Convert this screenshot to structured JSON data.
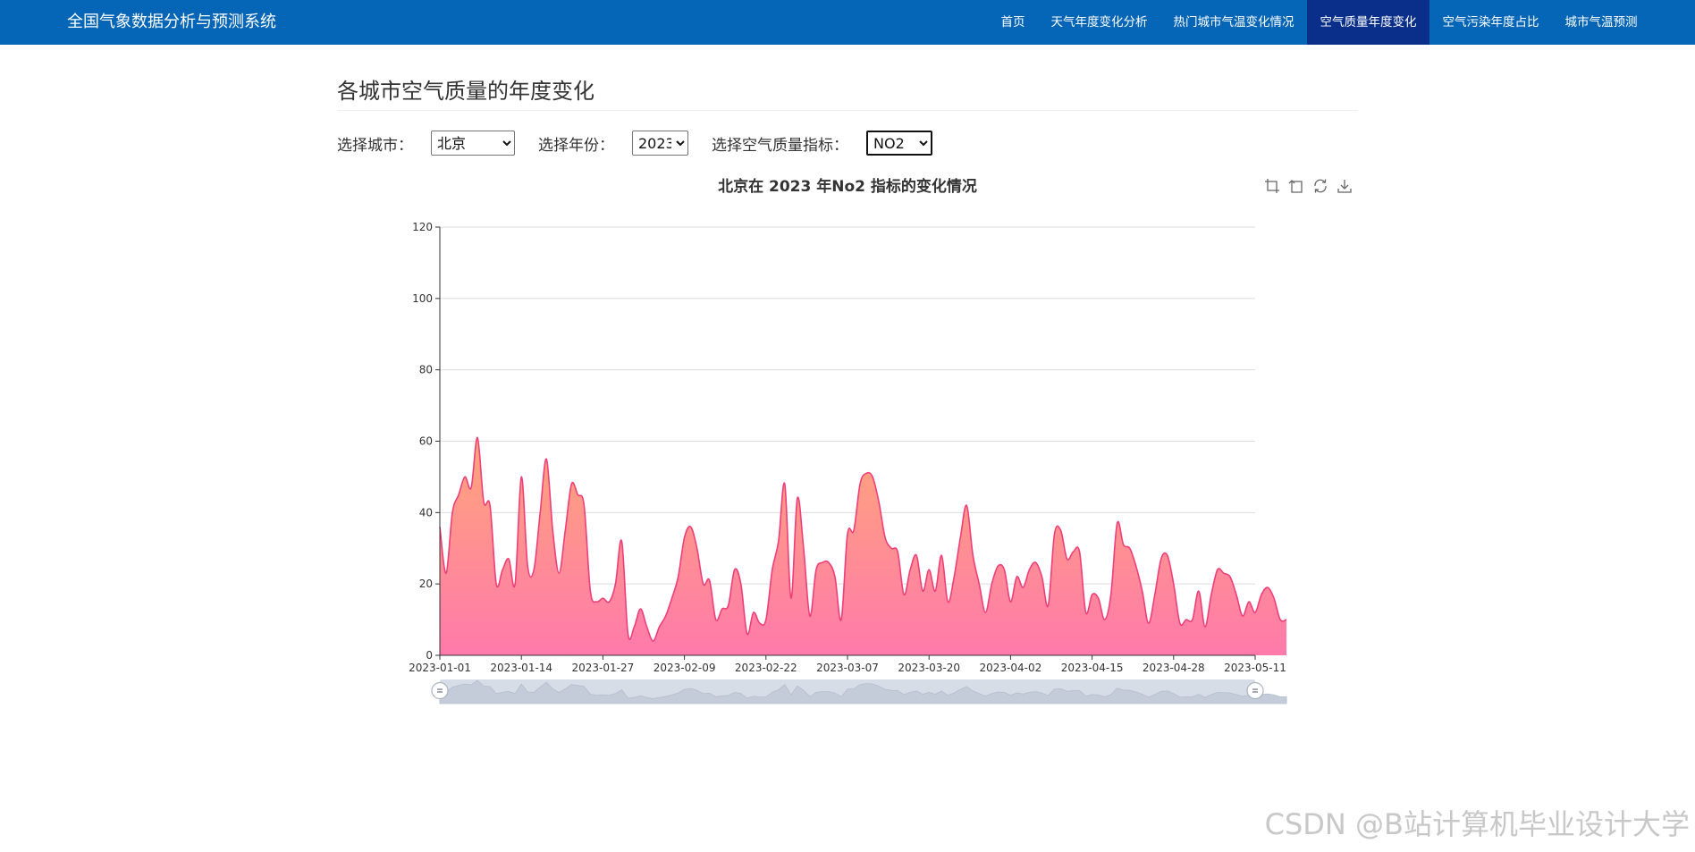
{
  "navbar": {
    "brand": "全国气象数据分析与预测系统",
    "items": [
      {
        "label": "首页",
        "active": false
      },
      {
        "label": "天气年度变化分析",
        "active": false
      },
      {
        "label": "热门城市气温变化情况",
        "active": false
      },
      {
        "label": "空气质量年度变化",
        "active": true
      },
      {
        "label": "空气污染年度占比",
        "active": false
      },
      {
        "label": "城市气温预测",
        "active": false
      }
    ]
  },
  "main": {
    "title": "各城市空气质量的年度变化",
    "filters": {
      "city_label": "选择城市：",
      "city_value": "北京",
      "year_label": "选择年份：",
      "year_value": "2023",
      "metric_label": "选择空气质量指标：",
      "metric_value": "NO2"
    }
  },
  "toolbox": [
    "zoom-icon",
    "zoom-reset-icon",
    "restore-icon",
    "download-icon"
  ],
  "chart_data": {
    "type": "area",
    "title": "北京在 2023 年No2 指标的变化情况",
    "xlabel": "",
    "ylabel": "",
    "ylim": [
      0,
      120
    ],
    "yticks": [
      0,
      20,
      40,
      60,
      80,
      100,
      120
    ],
    "x_tick_labels": [
      "2023-01-01",
      "2023-01-14",
      "2023-01-27",
      "2023-02-09",
      "2023-02-22",
      "2023-03-07",
      "2023-03-20",
      "2023-04-02",
      "2023-04-15",
      "2023-04-28",
      "2023-05-11"
    ],
    "x_start": "2023-01-01",
    "x_end": "2023-05-11",
    "grid": true,
    "colors": {
      "line": "#ee3f79",
      "area_top": "#ffa57a",
      "area_bottom": "#ff7aab",
      "grid": "#dddddd",
      "slider": "#d6dde6"
    },
    "series": [
      {
        "values": [
          36,
          23,
          40,
          45,
          50,
          47,
          61,
          43,
          42,
          20,
          24,
          27,
          20,
          50,
          25,
          24,
          40,
          55,
          35,
          23,
          35,
          48,
          45,
          42,
          18,
          15,
          16,
          15,
          20,
          32,
          6,
          8,
          13,
          8,
          4,
          8,
          11,
          16,
          22,
          33,
          36,
          30,
          20,
          21,
          10,
          13,
          14,
          24,
          20,
          6,
          12,
          9,
          10,
          24,
          32,
          48,
          16,
          44,
          30,
          11,
          24,
          26,
          26,
          22,
          10,
          34,
          35,
          48,
          51,
          50,
          43,
          33,
          30,
          29,
          17,
          24,
          28,
          18,
          24,
          18,
          28,
          15,
          22,
          33,
          42,
          28,
          20,
          12,
          20,
          25,
          24,
          15,
          22,
          19,
          24,
          26,
          22,
          14,
          34,
          35,
          27,
          29,
          29,
          12,
          17,
          16,
          10,
          17,
          37,
          31,
          30,
          25,
          18,
          9,
          17,
          27,
          28,
          20,
          9,
          10,
          10,
          18,
          8,
          17,
          24,
          23,
          22,
          17,
          11,
          15,
          12,
          17,
          19,
          16,
          10,
          10
        ]
      }
    ]
  },
  "watermark": "CSDN @B站计算机毕业设计大学"
}
